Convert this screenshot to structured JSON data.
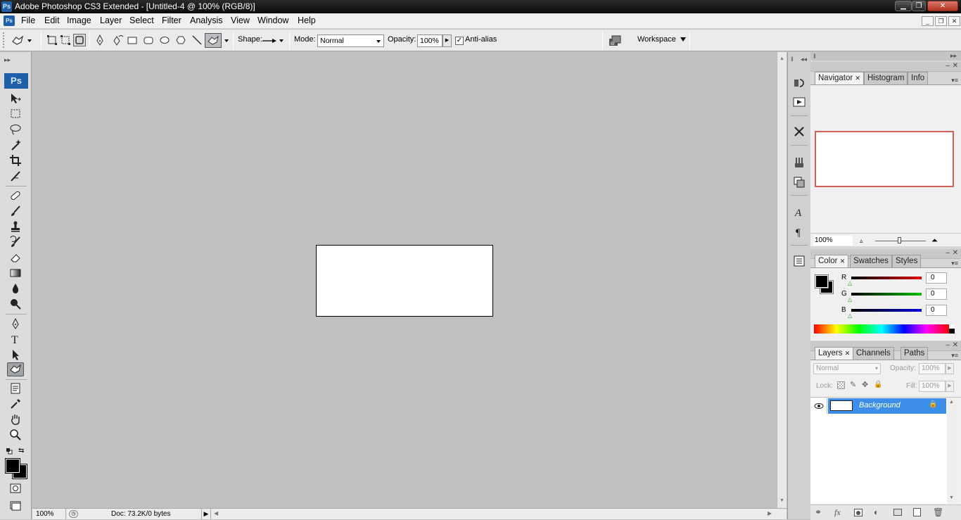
{
  "window": {
    "title": "Adobe Photoshop CS3 Extended - [Untitled-4 @ 100% (RGB/8)]",
    "app_icon": "Ps"
  },
  "menubar": {
    "items": [
      "File",
      "Edit",
      "Image",
      "Layer",
      "Select",
      "Filter",
      "Analysis",
      "View",
      "Window",
      "Help"
    ]
  },
  "options_bar": {
    "shape_label": "Shape:",
    "mode_label": "Mode:",
    "mode_value": "Normal",
    "opacity_label": "Opacity:",
    "opacity_value": "100%",
    "antialias_label": "Anti-alias",
    "antialias_checked": true,
    "workspace_label": "Workspace"
  },
  "toolbox": {
    "logo": "Ps",
    "active_tool": "custom-shape-tool"
  },
  "statusbar": {
    "zoom": "100%",
    "doc_info": "Doc: 73.2K/0 bytes"
  },
  "navigator_panel": {
    "tabs": [
      "Navigator",
      "Histogram",
      "Info"
    ],
    "zoom_value": "100%",
    "view_box_color": "#d0605a"
  },
  "color_panel": {
    "tabs": [
      "Color",
      "Swatches",
      "Styles"
    ],
    "channels": [
      {
        "label": "R",
        "value": "0",
        "color": "#e00000"
      },
      {
        "label": "G",
        "value": "0",
        "color": "#00c000"
      },
      {
        "label": "B",
        "value": "0",
        "color": "#0000e0"
      }
    ]
  },
  "layers_panel": {
    "tabs": [
      "Layers",
      "Channels",
      "Paths"
    ],
    "blend_mode": "Normal",
    "opacity_label": "Opacity:",
    "opacity_value": "100%",
    "lock_label": "Lock:",
    "fill_label": "Fill:",
    "fill_value": "100%",
    "layers": [
      {
        "name": "Background",
        "visible": true,
        "locked": true,
        "selected": true
      }
    ]
  },
  "colors": {
    "selection_blue": "#3d8ee8",
    "foreground": "#000000",
    "background": "#ffffff"
  }
}
